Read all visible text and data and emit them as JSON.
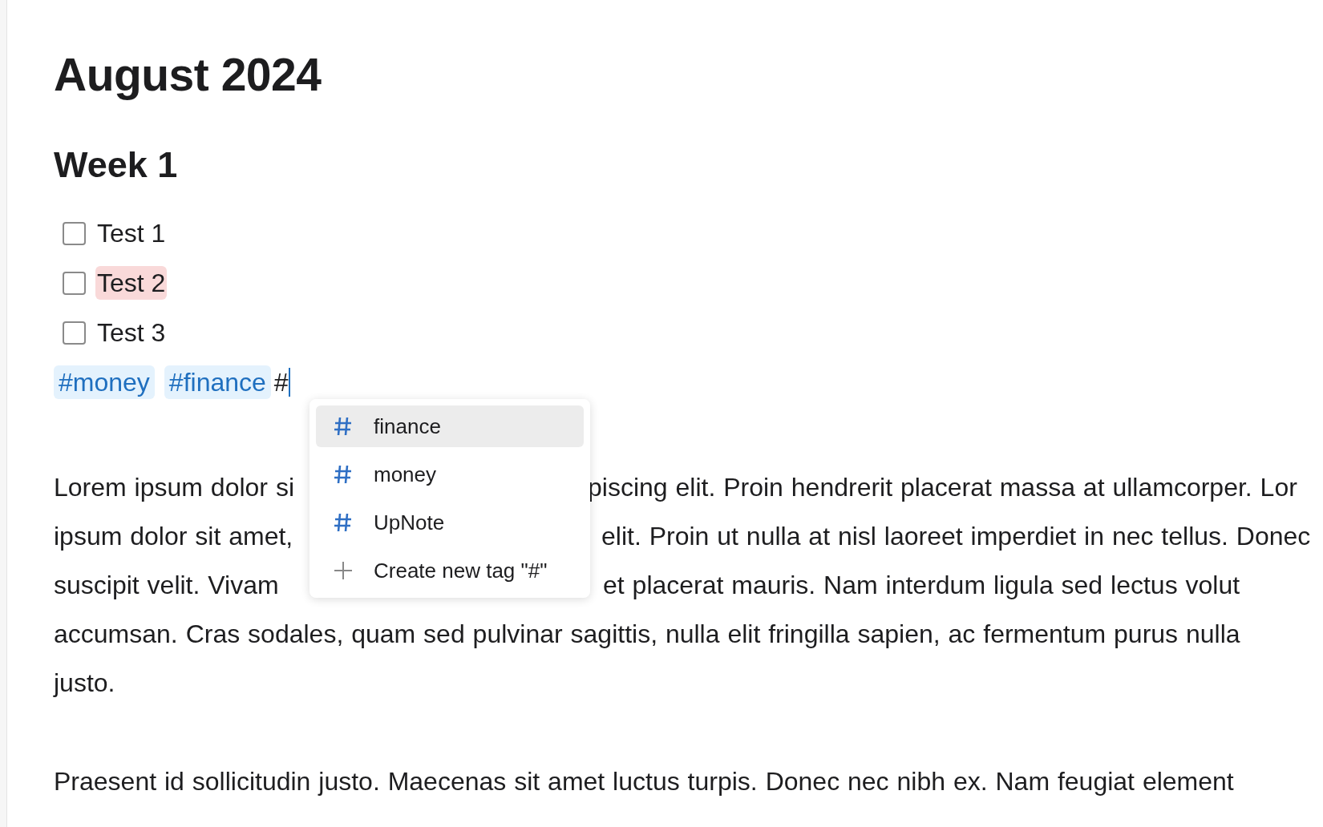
{
  "title": "August 2024",
  "heading": "Week 1",
  "tasks": [
    {
      "label": "Test 1",
      "checked": false,
      "highlighted": false
    },
    {
      "label": "Test 2",
      "checked": false,
      "highlighted": true
    },
    {
      "label": "Test 3",
      "checked": false,
      "highlighted": false
    }
  ],
  "tags": [
    "#money",
    "#finance"
  ],
  "typed": "#",
  "suggestions": [
    {
      "kind": "tag",
      "label": "finance",
      "selected": true
    },
    {
      "kind": "tag",
      "label": "money",
      "selected": false
    },
    {
      "kind": "tag",
      "label": "UpNote",
      "selected": false
    },
    {
      "kind": "create",
      "label": "Create new tag \"#\"",
      "selected": false
    }
  ],
  "paragraphs": [
    [
      {
        "left": "Lorem ipsum dolor si",
        "right": "piscing elit. Proin hendrerit placerat massa at ullamcorper. Lor"
      },
      {
        "left": "ipsum dolor sit amet,",
        "right": "elit. Proin ut nulla at nisl laoreet imperdiet in nec tellus. Donec"
      },
      {
        "left": "suscipit velit. Vivam",
        "right": "et placerat mauris. Nam interdum ligula sed lectus volut"
      },
      {
        "left": "accumsan. Cras sodales, quam sed pulvinar sagittis, nulla elit fringilla sapien, ac fermentum purus nulla"
      },
      {
        "left": "justo."
      }
    ],
    [
      {
        "left": "Praesent id sollicitudin justo. Maecenas sit amet luctus turpis. Donec nec nibh ex. Nam feugiat element"
      }
    ]
  ]
}
